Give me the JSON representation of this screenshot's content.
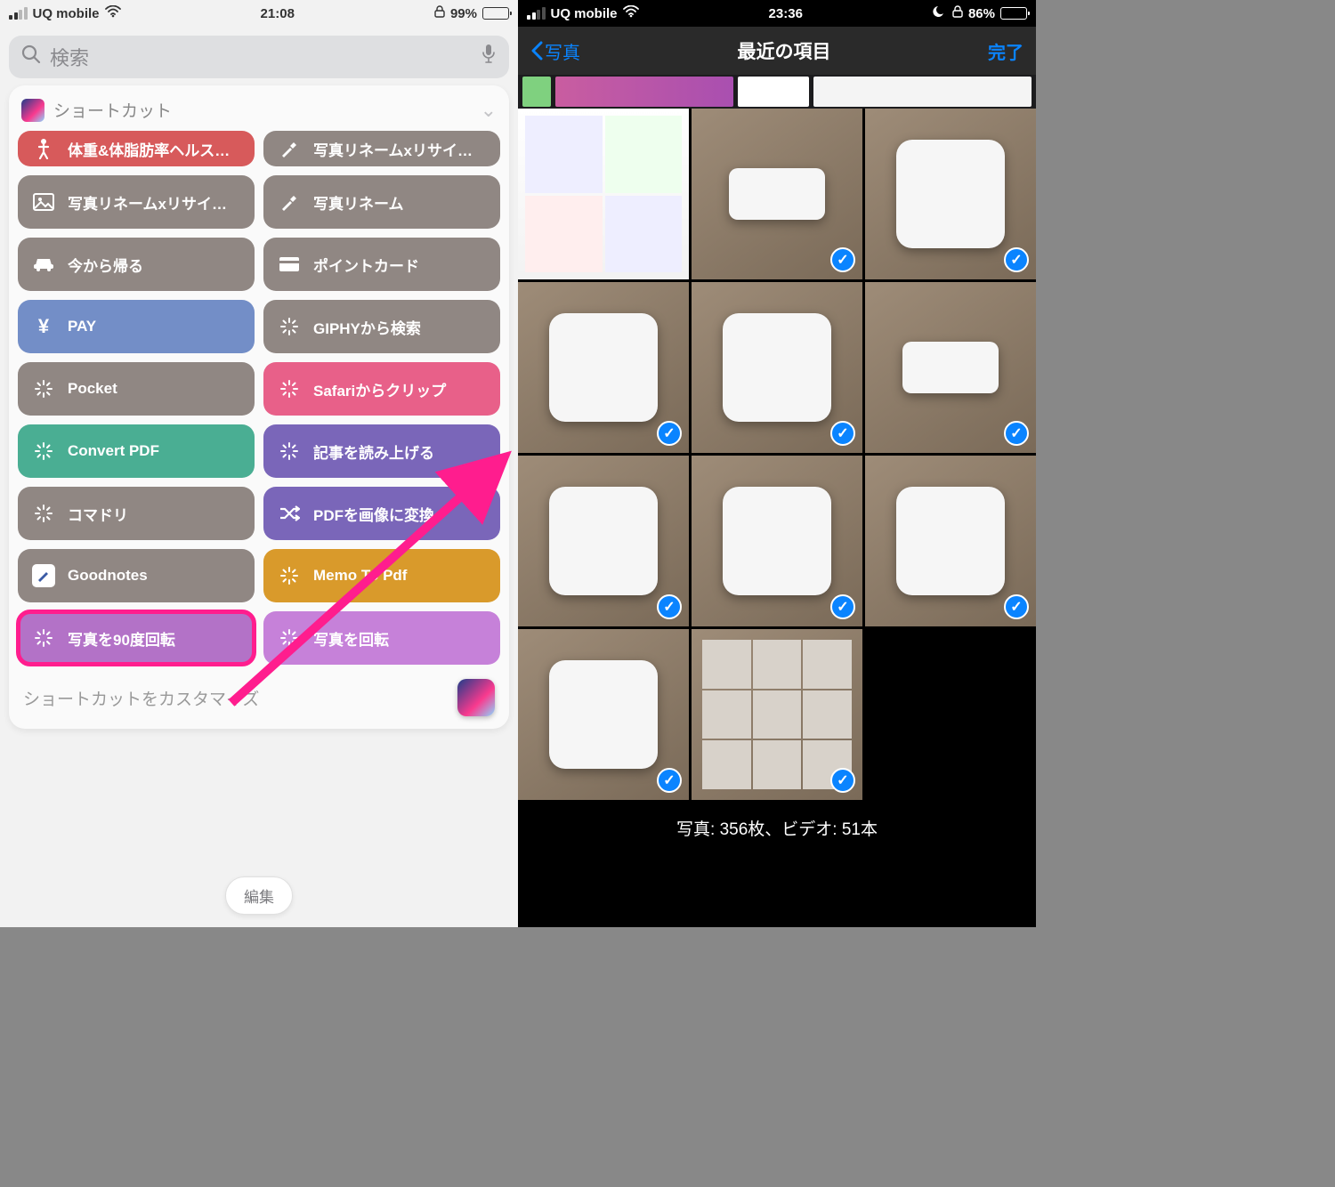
{
  "left": {
    "status": {
      "carrier": "UQ mobile",
      "time": "21:08",
      "battery_pct": "99%",
      "battery_fill": 99
    },
    "search_placeholder": "検索",
    "widget_title": "ショートカット",
    "tiles": [
      {
        "label": "体重&体脂肪率ヘルス…",
        "bg": "#d75a5b",
        "icon": "body"
      },
      {
        "label": "写真リネームxリサイ…",
        "bg": "#908783",
        "icon": "hammer"
      },
      {
        "label": "写真リネームxリサイ…",
        "bg": "#908783",
        "icon": "photo"
      },
      {
        "label": "写真リネーム",
        "bg": "#908783",
        "icon": "hammer"
      },
      {
        "label": "今から帰る",
        "bg": "#908783",
        "icon": "car"
      },
      {
        "label": "ポイントカード",
        "bg": "#908783",
        "icon": "card"
      },
      {
        "label": "PAY",
        "bg": "#738ec7",
        "icon": "yen"
      },
      {
        "label": "GIPHYから検索",
        "bg": "#908783",
        "icon": "spark"
      },
      {
        "label": "Pocket",
        "bg": "#908783",
        "icon": "spark"
      },
      {
        "label": "Safariからクリップ",
        "bg": "#e86089",
        "icon": "spark"
      },
      {
        "label": "Convert PDF",
        "bg": "#4aae93",
        "icon": "spark"
      },
      {
        "label": "記事を読み上げる",
        "bg": "#7a66b9",
        "icon": "spark"
      },
      {
        "label": "コマドリ",
        "bg": "#908783",
        "icon": "spark"
      },
      {
        "label": "PDFを画像に変換",
        "bg": "#7a66b9",
        "icon": "shuffle"
      },
      {
        "label": "Goodnotes",
        "bg": "#908783",
        "icon": "note"
      },
      {
        "label": "Memo To Pdf",
        "bg": "#d99a2b",
        "icon": "spark"
      },
      {
        "label": "写真を90度回転",
        "bg": "#b372c7",
        "icon": "spark",
        "highlight": true
      },
      {
        "label": "写真を回転",
        "bg": "#c681d9",
        "icon": "spark"
      }
    ],
    "footer_text": "ショートカットをカスタマイズ",
    "edit_button": "編集"
  },
  "right": {
    "status": {
      "carrier": "UQ mobile",
      "time": "23:36",
      "battery_pct": "86%",
      "battery_fill": 86
    },
    "nav": {
      "back": "写真",
      "title": "最近の項目",
      "done": "完了"
    },
    "photos": [
      {
        "kind": "screens",
        "checked": false
      },
      {
        "kind": "phone",
        "checked": true
      },
      {
        "kind": "case",
        "checked": true
      },
      {
        "kind": "case",
        "checked": true
      },
      {
        "kind": "case",
        "checked": true
      },
      {
        "kind": "phone",
        "checked": true
      },
      {
        "kind": "items",
        "checked": true
      },
      {
        "kind": "case",
        "checked": true
      },
      {
        "kind": "case",
        "checked": true
      },
      {
        "kind": "case",
        "checked": true
      },
      {
        "kind": "grid9",
        "checked": true
      },
      {
        "kind": "empty",
        "checked": false
      }
    ],
    "bottom_info": "写真: 356枚、ビデオ: 51本"
  }
}
